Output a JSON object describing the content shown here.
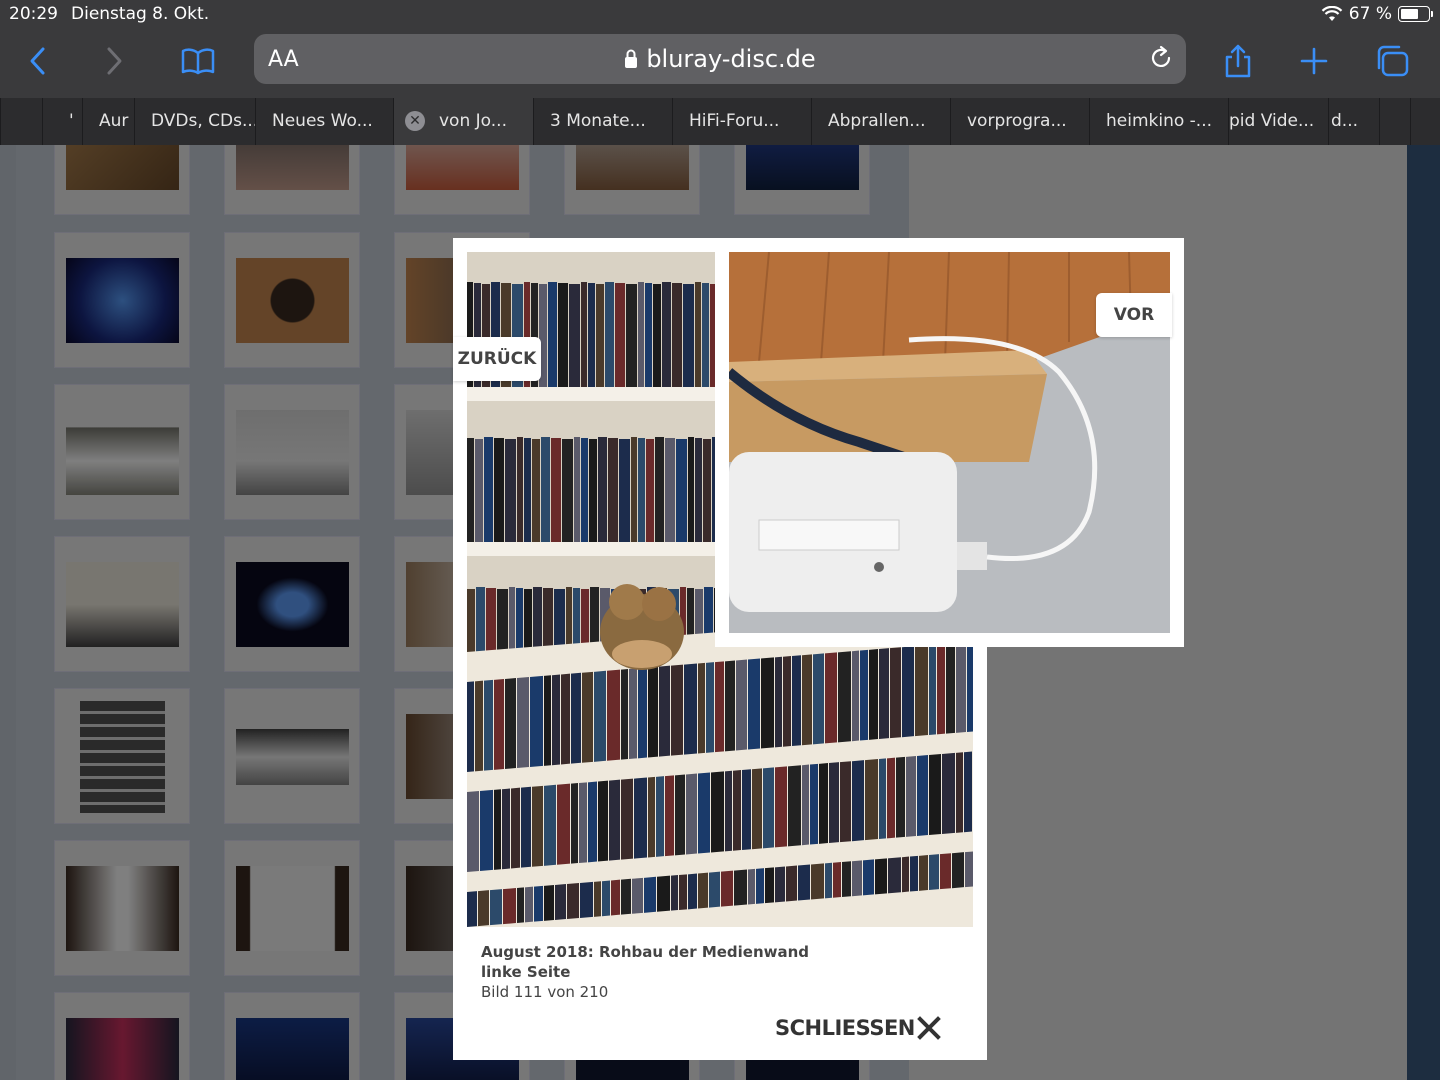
{
  "status_bar": {
    "time": "20:29",
    "date": "Dienstag 8. Okt.",
    "battery_percent": "67 %",
    "battery_level": 0.67,
    "wifi_icon": "wifi-icon"
  },
  "toolbar": {
    "text_size_label": "AA",
    "url_host": "bluray-disc.de",
    "icons": [
      "back-icon",
      "forward-icon",
      "bookmarks-icon",
      "lock-icon",
      "reload-icon",
      "share-icon",
      "new-tab-icon",
      "tabs-icon"
    ]
  },
  "tabs": [
    {
      "label": "Aur",
      "active": false
    },
    {
      "label": "DVDs, CDs...",
      "active": false
    },
    {
      "label": "Neues Wo...",
      "active": false
    },
    {
      "label": "von Jo...",
      "active": true
    },
    {
      "label": "3 Monate...",
      "active": false
    },
    {
      "label": "HiFi-Foru...",
      "active": false
    },
    {
      "label": "Abprallen...",
      "active": false
    },
    {
      "label": "vorprogra...",
      "active": false
    },
    {
      "label": "heimkino -...",
      "active": false
    },
    {
      "label": "pid Vide...",
      "active": false
    },
    {
      "label": "d...",
      "active": false
    }
  ],
  "lightbox": {
    "title_line1": "August 2018: Rohbau der Medienwand",
    "title_line2": "linke Seite",
    "counter": "Bild 111 von 210",
    "close_label": "SCHLIESSEN",
    "prev_label": "ZURÜCK",
    "next_label": "VOR"
  },
  "colors": {
    "accent": "#3a8ef6",
    "chrome": "#3a3a3c"
  }
}
